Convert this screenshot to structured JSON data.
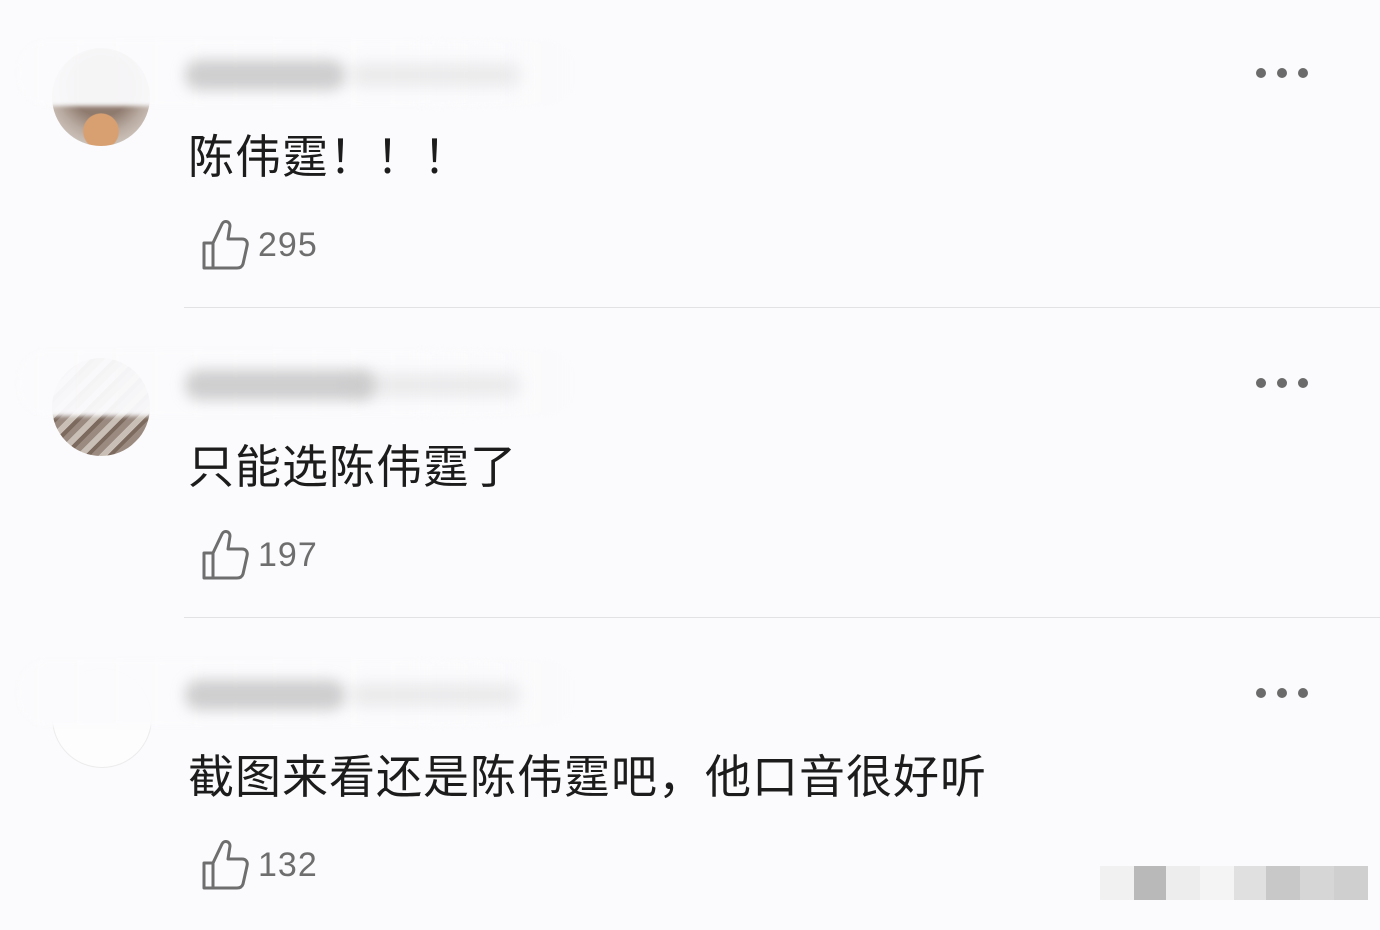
{
  "comments": [
    {
      "text": "陈伟霆！！！",
      "likes": "295"
    },
    {
      "text": "只能选陈伟霆了",
      "likes": "197"
    },
    {
      "text": "截图来看还是陈伟霆吧，他口音很好听",
      "likes": "132"
    }
  ],
  "icons": {
    "more": "more-dots-icon",
    "like": "thumbs-up-icon"
  },
  "colors": {
    "background": "#fbfbfd",
    "text": "#1c1c1c",
    "like_count": "#6e6e6e",
    "divider": "#e2e2e4",
    "more_icon": "#6b6b6b"
  }
}
